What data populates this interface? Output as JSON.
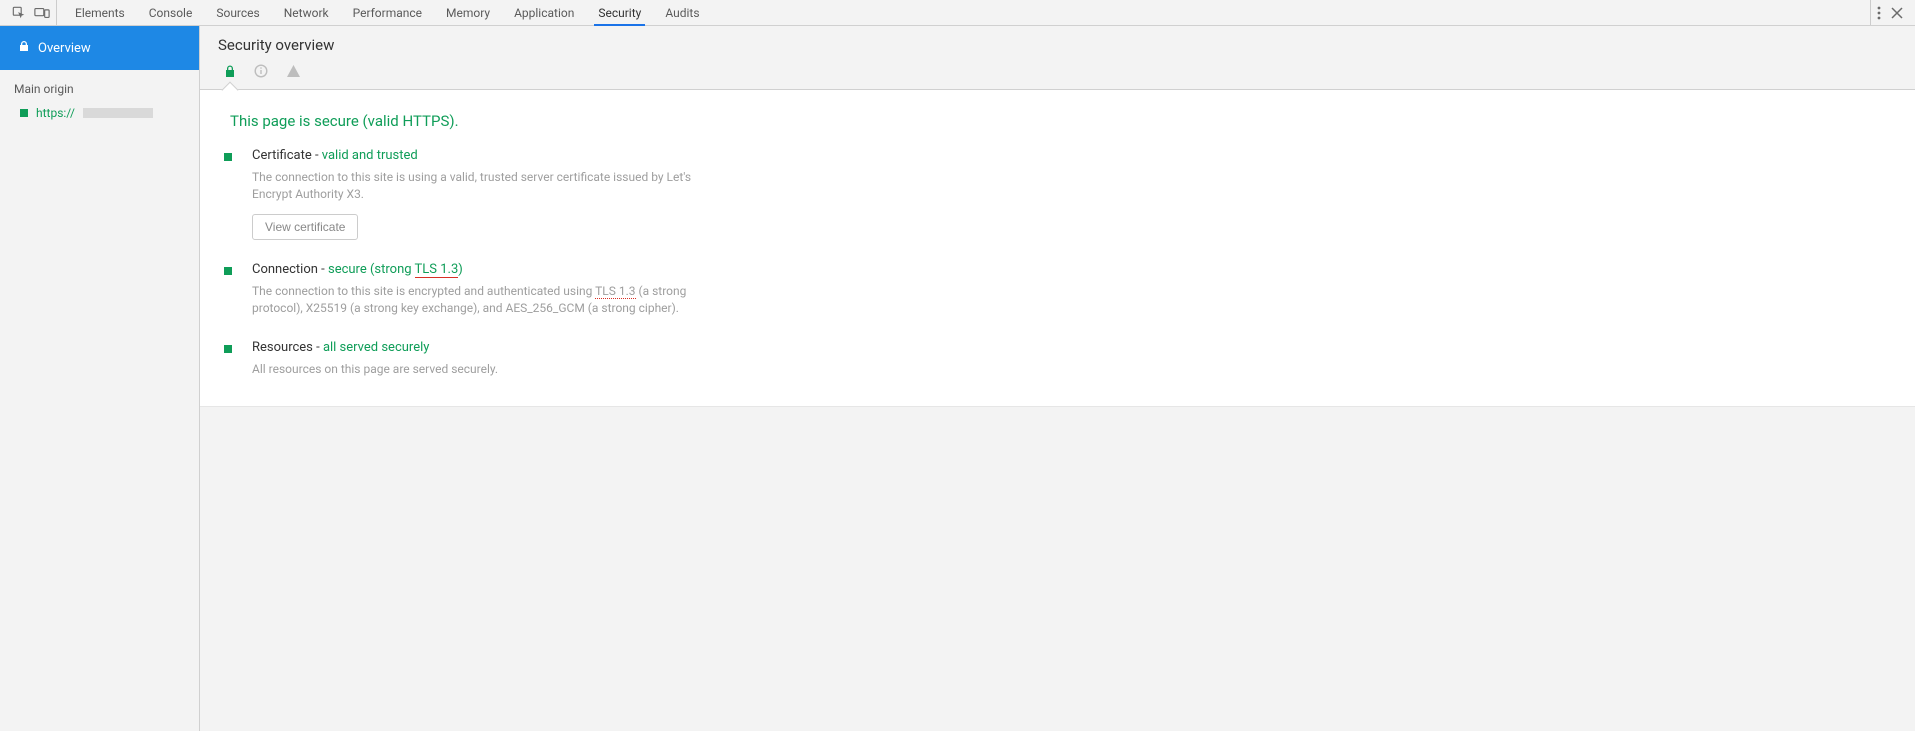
{
  "tabs": [
    "Elements",
    "Console",
    "Sources",
    "Network",
    "Performance",
    "Memory",
    "Application",
    "Security",
    "Audits"
  ],
  "active_tab_index": 7,
  "sidebar": {
    "overview_label": "Overview",
    "main_origin_header": "Main origin",
    "origin_protocol": "https://"
  },
  "header": {
    "title": "Security overview"
  },
  "overview": {
    "headline": "This page is secure (valid HTTPS).",
    "sections": [
      {
        "title_prefix": "Certificate - ",
        "title_status": "valid and trusted",
        "description": "The connection to this site is using a valid, trusted server certificate issued by Let's Encrypt Authority X3.",
        "button_label": "View certificate"
      },
      {
        "title_prefix": "Connection - ",
        "title_status_pre": "secure (strong ",
        "title_status_tls": "TLS 1.3",
        "title_status_post": ")",
        "desc_pre": "The connection to this site is encrypted and authenticated using ",
        "desc_tls": "TLS 1.3",
        "desc_post": " (a strong protocol), X25519 (a strong key exchange), and AES_256_GCM (a strong cipher)."
      },
      {
        "title_prefix": "Resources - ",
        "title_status": "all served securely",
        "description": "All resources on this page are served securely."
      }
    ]
  }
}
